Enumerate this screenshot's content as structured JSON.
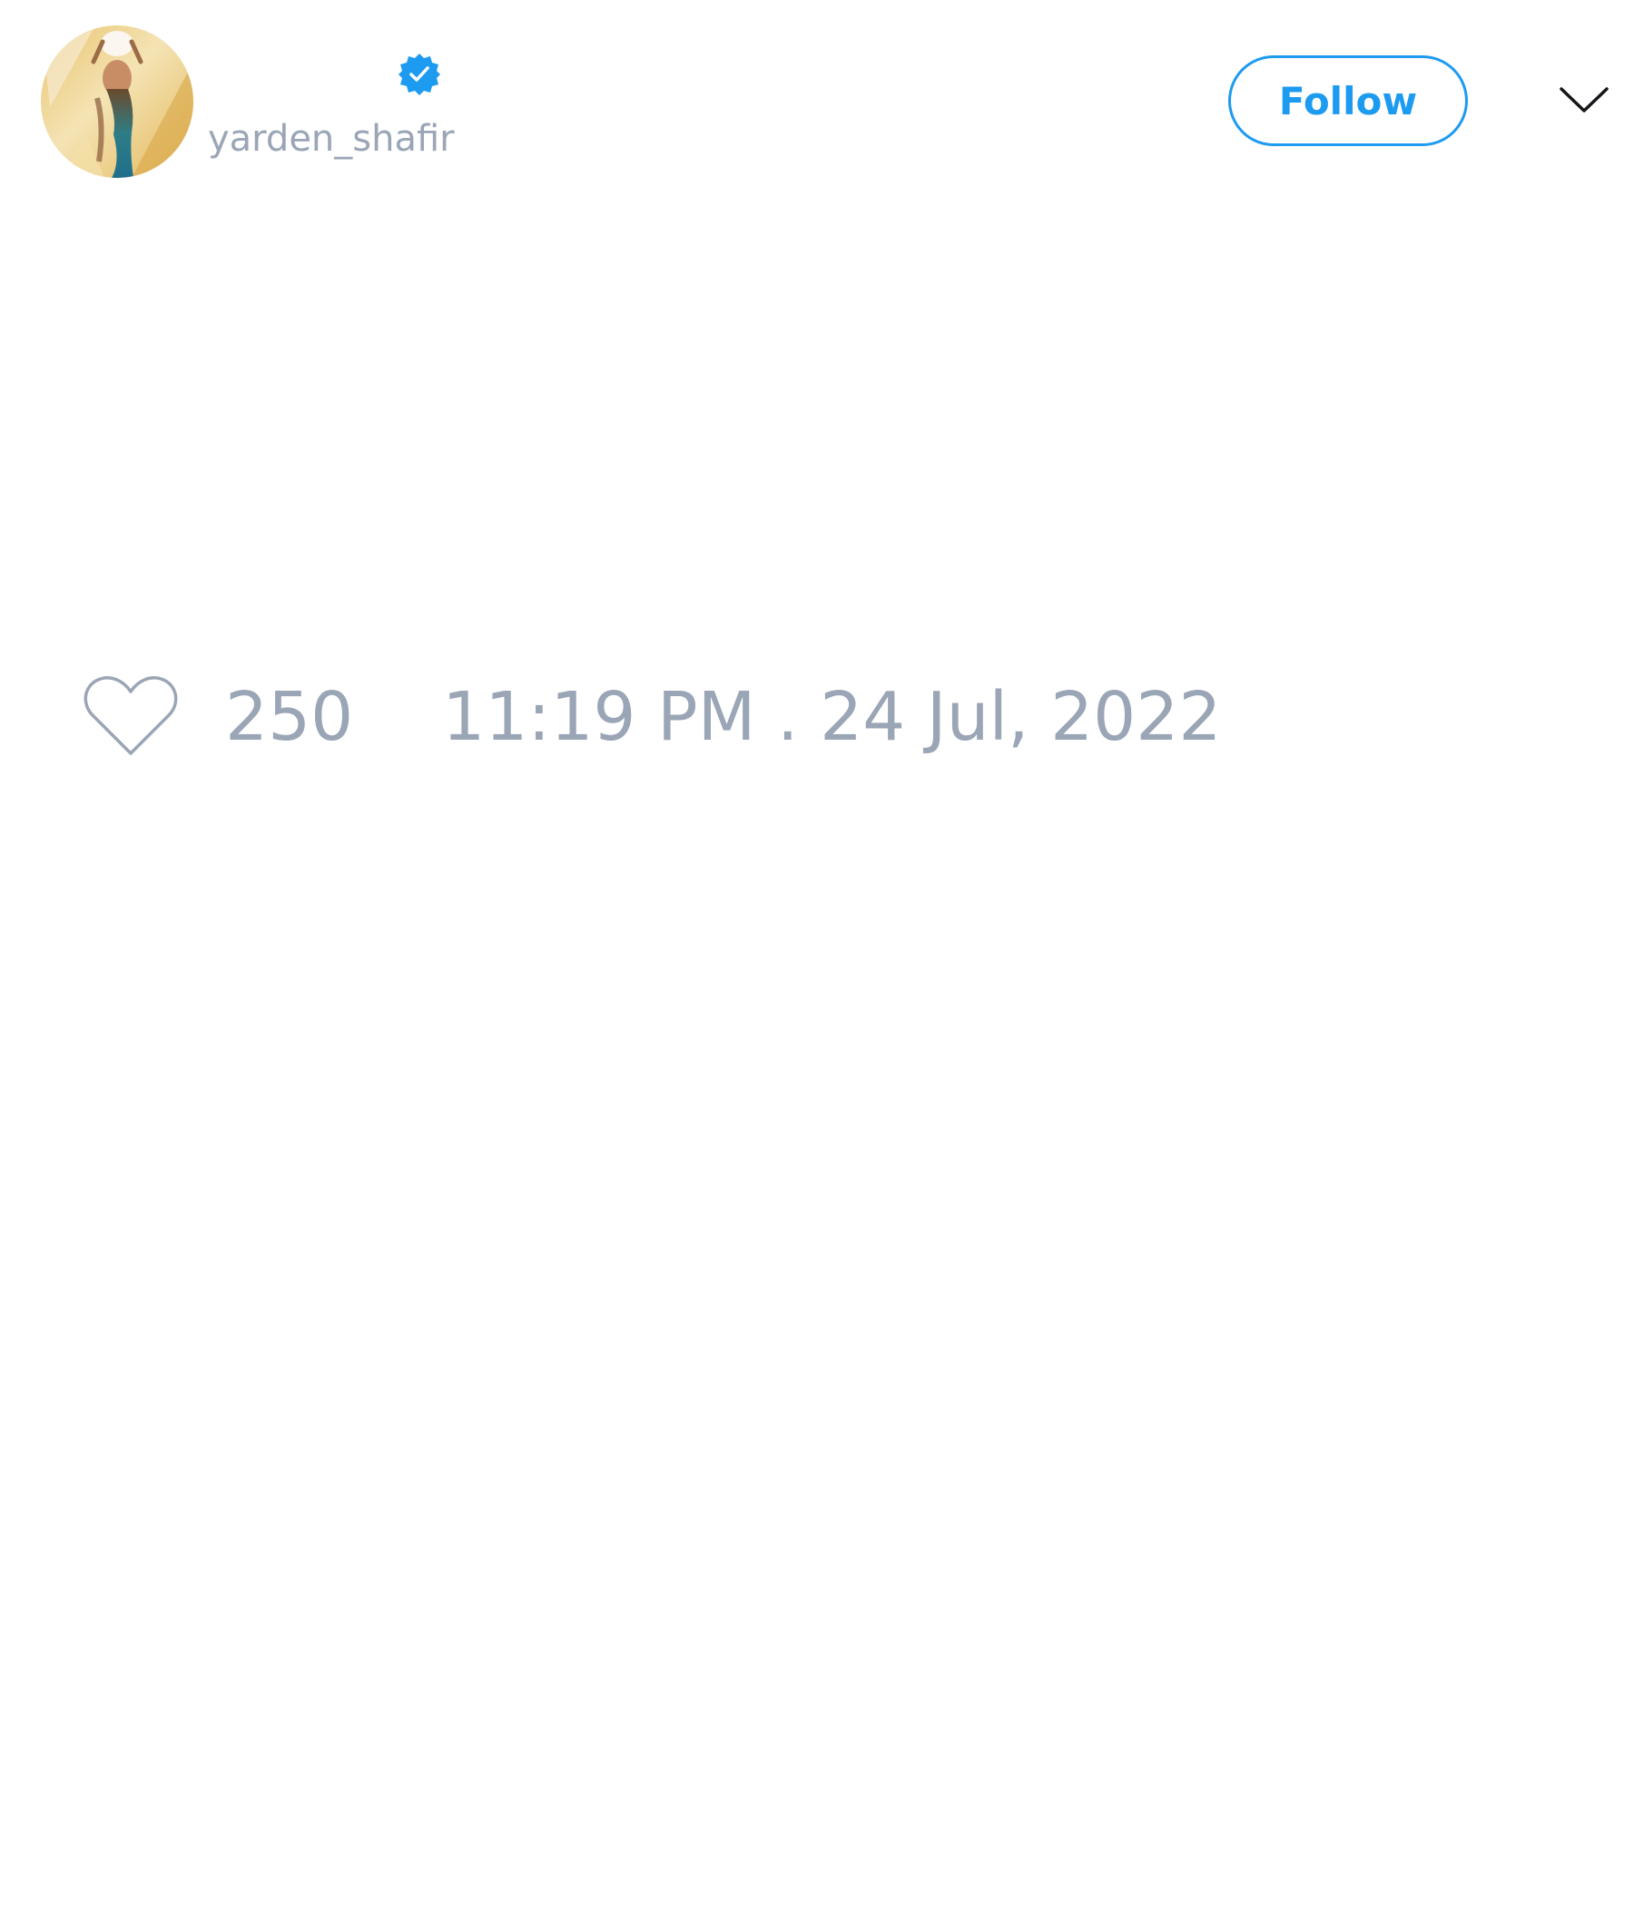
{
  "tweet": {
    "author": {
      "display_name": "",
      "handle": "yarden_shafir",
      "verified": true,
      "avatar_icon": "profile-photo"
    },
    "follow_label": "Follow",
    "menu_icon": "chevron-down-icon",
    "text": "",
    "likes": {
      "icon": "heart-outline-icon",
      "count": "250"
    },
    "timestamp": "11:19 PM . 24 Jul, 2022"
  },
  "colors": {
    "accent": "#1d9bf0",
    "muted_text": "#9aa5b6",
    "background": "#ffffff"
  }
}
